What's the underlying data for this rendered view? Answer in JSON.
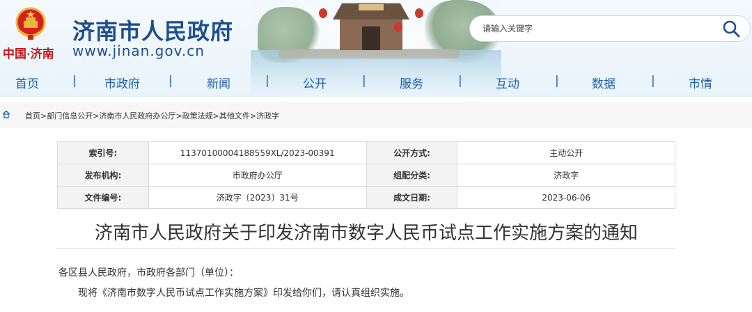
{
  "header": {
    "site_name": "济南市人民政府",
    "site_url": "www.jinan.gov.cn",
    "logo_text": "中国·济南",
    "search": {
      "placeholder": "请输入关键字",
      "value": ""
    }
  },
  "nav": {
    "items": [
      "首页",
      "市政府",
      "新闻",
      "公开",
      "服务",
      "互动",
      "数据",
      "市情"
    ],
    "separator": "|"
  },
  "breadcrumb": {
    "items": [
      "首页",
      "部门信息公开",
      "济南市人民政府办公厅",
      "政策法规",
      "其他文件",
      "济政字"
    ],
    "separator": ">"
  },
  "info_table": {
    "rows": [
      {
        "label1": "索引号:",
        "value1": "11370100004188559XL/2023-00391",
        "label2": "公开方式:",
        "value2": "主动公开"
      },
      {
        "label1": "发布机构:",
        "value1": "市政府办公厅",
        "label2": "组配分类:",
        "value2": "济政字"
      },
      {
        "label1": "文件编号:",
        "value1": "济政字〔2023〕31号",
        "label2": "成文日期:",
        "value2": "2023-06-06"
      }
    ]
  },
  "document": {
    "title": "济南市人民政府关于印发济南市数字人民币试点工作实施方案的通知",
    "salutation": "各区县人民政府，市政府各部门（单位）：",
    "paragraph": "现将《济南市数字人民币试点工作实施方案》印发给你们，请认真组织实施。"
  },
  "colors": {
    "brand_blue": "#1f4e8c",
    "nav_blue": "#1f5fa8",
    "logo_red": "#c8161d"
  },
  "icons": [
    "national-emblem-icon",
    "search-icon",
    "home-icon"
  ]
}
